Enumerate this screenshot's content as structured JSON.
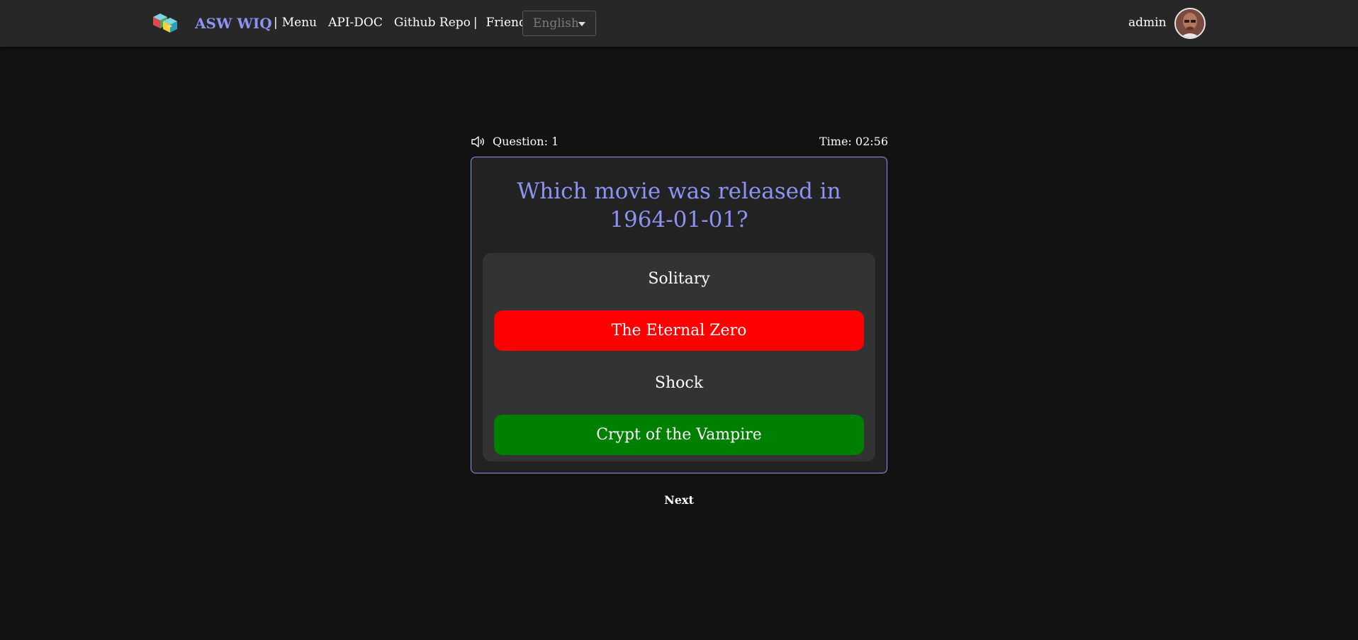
{
  "header": {
    "brand": "ASW WIQ",
    "nav": {
      "separator": "|",
      "menu": "Menu",
      "api_doc": "API-DOC",
      "github": "Github Repo",
      "separator2": "|",
      "friends": "Friends"
    },
    "language": {
      "selected": "English"
    },
    "user": {
      "name": "admin"
    }
  },
  "quiz": {
    "question_label": "Question: 1",
    "timer_label": "Time: 02:56",
    "question_text": "Which movie was released in 1964-01-01?",
    "answers": [
      {
        "text": "Solitary",
        "state": "neutral",
        "color": "#333333"
      },
      {
        "text": "The Eternal Zero",
        "state": "wrong",
        "color": "#ff0000"
      },
      {
        "text": "Shock",
        "state": "neutral",
        "color": "#333333"
      },
      {
        "text": "Crypt of the Vampire",
        "state": "correct",
        "color": "#008000"
      }
    ],
    "next_label": "Next"
  },
  "icons": {
    "logo": "cubes-logo-icon",
    "sound": "speaker-icon",
    "dropdown": "caret-down-icon",
    "avatar": "user-avatar"
  },
  "colors": {
    "accent": "#8c93f2",
    "header_bg": "#272727",
    "page_bg": "#121212",
    "card_bg": "#222222",
    "answers_bg": "#333333"
  }
}
